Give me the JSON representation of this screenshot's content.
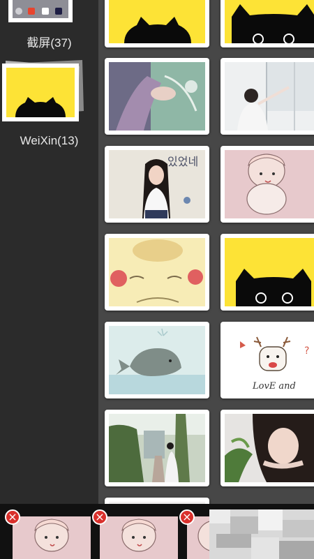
{
  "sidebar": {
    "albums": [
      {
        "label": "截屏(37)",
        "thumb": "screenshot-thumbnail"
      },
      {
        "label": "WeiXin(13)",
        "thumb": "black-cat-yellow-thumbnail"
      }
    ]
  },
  "grid": {
    "photos": [
      {
        "subject": "black-cat-on-yellow"
      },
      {
        "subject": "black-cat-on-yellow"
      },
      {
        "subject": "hands-with-hair-tie"
      },
      {
        "subject": "girl-at-window"
      },
      {
        "subject": "girl-with-flower-wall"
      },
      {
        "subject": "girl-with-cat-drawing"
      },
      {
        "subject": "pikachu-closeup"
      },
      {
        "subject": "black-cat-on-yellow"
      },
      {
        "subject": "whale-drawing"
      },
      {
        "subject": "deer-love-and-drawing"
      },
      {
        "subject": "girl-in-garden-lane"
      },
      {
        "subject": "girl-lying-with-leaves"
      }
    ]
  },
  "tray": {
    "selected": [
      {
        "subject": "girl-with-cat-drawing"
      },
      {
        "subject": "girl-with-cat-drawing"
      },
      {
        "subject": "girl-with-cat-drawing"
      }
    ],
    "remove_symbol": "×"
  },
  "colors": {
    "sidebar_bg": "#2b2b2b",
    "grid_bg": "#474747",
    "accent_yellow": "#fde336",
    "remove_red": "#d9302c"
  }
}
